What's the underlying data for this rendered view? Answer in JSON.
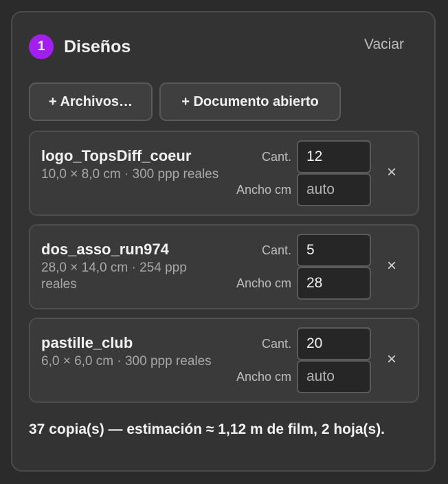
{
  "header": {
    "step": "1",
    "title": "Diseños",
    "clear_label": "Vaciar"
  },
  "actions": {
    "files_label": "+ Archivos…",
    "open_doc_label": "+ Documento abierto"
  },
  "labels": {
    "qty": "Cant.",
    "width": "Ancho cm",
    "remove": "×"
  },
  "designs": [
    {
      "name": "logo_TopsDiff_coeur",
      "meta": "10,0 × 8,0 cm · 300 ppp reales",
      "qty": "12",
      "width": "",
      "width_placeholder": "auto"
    },
    {
      "name": "dos_asso_run974",
      "meta": "28,0 × 14,0 cm · 254 ppp reales",
      "qty": "5",
      "width": "28",
      "width_placeholder": "auto"
    },
    {
      "name": "pastille_club",
      "meta": "6,0 × 6,0 cm · 300 ppp reales",
      "qty": "20",
      "width": "",
      "width_placeholder": "auto"
    }
  ],
  "summary": "37 copia(s) — estimación ≈ 1,12 m de film, 2 hoja(s).",
  "colors": {
    "accent": "#a21ff0",
    "panel": "#333333",
    "background": "#2b2b2b"
  }
}
